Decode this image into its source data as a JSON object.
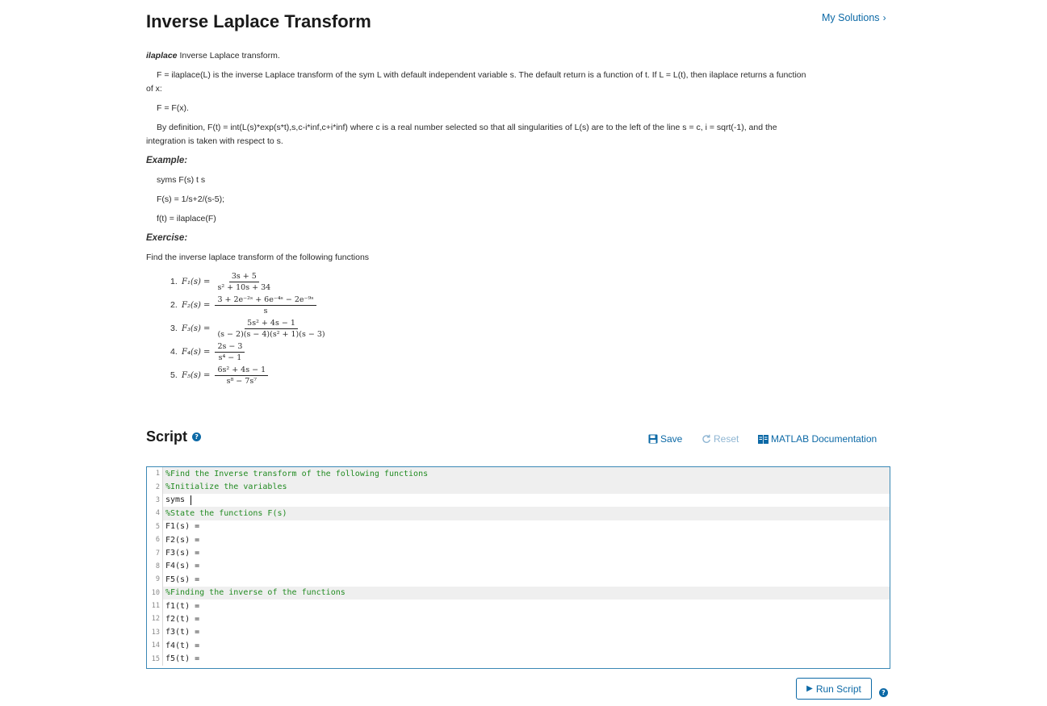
{
  "header": {
    "title": "Inverse Laplace Transform",
    "my_solutions": "My Solutions",
    "chevron": "›"
  },
  "description": {
    "fn_name": "ilaplace",
    "fn_summary": " Inverse Laplace transform.",
    "para1": "F = ilaplace(L) is the inverse Laplace transform of the sym L with default independent variable s.  The default return is a function of t.  If L = L(t), then ilaplace returns a function",
    "para1_cont": "of x:",
    "para2": "F = F(x).",
    "para3": "By definition, F(t) = int(L(s)*exp(s*t),s,c-i*inf,c+i*inf)  where c is a real number selected so that all singularities of L(s) are to the left of the line s = c, i = sqrt(-1), and the",
    "para3_cont": "integration is taken with respect to s.",
    "example_heading": "Example:",
    "example_lines": [
      "syms F(s) t s",
      "F(s) = 1/s+2/(s-5);",
      "f(t) = ilaplace(F)"
    ],
    "exercise_heading": "Exercise:",
    "exercise_intro": "Find the inverse laplace transform of the following functions"
  },
  "problems": [
    {
      "num": "1.",
      "lhs": "F₁(s) =",
      "numer": "3s + 5",
      "denom": "s² + 10s + 34"
    },
    {
      "num": "2.",
      "lhs": "F₂(s) =",
      "numer": "3 + 2e⁻²ˢ + 6e⁻⁴ˢ − 2e⁻⁹ˢ",
      "denom": "s"
    },
    {
      "num": "3.",
      "lhs": "F₃(s) =",
      "numer": "5s² + 4s − 1",
      "denom": "(s − 2)(s − 4)(s² + 1)(s − 3)"
    },
    {
      "num": "4.",
      "lhs": "F₄(s) =",
      "numer": "2s − 3",
      "denom": "s⁴ − 1"
    },
    {
      "num": "5.",
      "lhs": "F₅(s) =",
      "numer": "6s² + 4s − 1",
      "denom": "s⁸ − 7s⁷"
    }
  ],
  "script": {
    "title": "Script",
    "help_glyph": "?",
    "save_label": "Save",
    "reset_label": "Reset",
    "doc_label": "MATLAB Documentation",
    "run_label": "Run Script",
    "run_glyph": "▶"
  },
  "code_lines": [
    {
      "n": "1",
      "text": "%Find the Inverse transform of the following functions"
    },
    {
      "n": "2",
      "text": "%Initialize the variables"
    },
    {
      "n": "3",
      "text": "syms "
    },
    {
      "n": "4",
      "text": "%State the functions F(s)"
    },
    {
      "n": "5",
      "text": "F1(s) ="
    },
    {
      "n": "6",
      "text": "F2(s) ="
    },
    {
      "n": "7",
      "text": "F3(s) ="
    },
    {
      "n": "8",
      "text": "F4(s) ="
    },
    {
      "n": "9",
      "text": "F5(s) ="
    },
    {
      "n": "10",
      "text": "%Finding the inverse of the functions"
    },
    {
      "n": "11",
      "text": "f1(t) ="
    },
    {
      "n": "12",
      "text": "f2(t) ="
    },
    {
      "n": "13",
      "text": "f3(t) ="
    },
    {
      "n": "14",
      "text": "f4(t) ="
    },
    {
      "n": "15",
      "text": "f5(t) ="
    }
  ],
  "colors": {
    "accent": "#0c69a6",
    "comment": "#228b22",
    "reset_disabled": "#8fb6d3",
    "editor_border": "#3a88b5"
  }
}
